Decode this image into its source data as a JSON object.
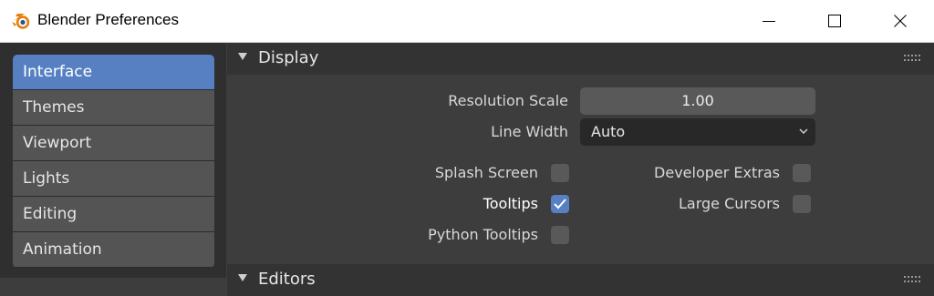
{
  "window": {
    "title": "Blender Preferences",
    "icons": {
      "app": "blender-logo-icon",
      "minimize": "minimize-icon",
      "maximize": "maximize-icon",
      "close": "close-icon"
    }
  },
  "sidebar": {
    "items": [
      {
        "label": "Interface",
        "active": true
      },
      {
        "label": "Themes",
        "active": false
      },
      {
        "label": "Viewport",
        "active": false
      },
      {
        "label": "Lights",
        "active": false
      },
      {
        "label": "Editing",
        "active": false
      },
      {
        "label": "Animation",
        "active": false
      }
    ]
  },
  "display": {
    "header": "Display",
    "resolution_scale": {
      "label": "Resolution Scale",
      "value": "1.00"
    },
    "line_width": {
      "label": "Line Width",
      "value": "Auto"
    },
    "checkboxes": {
      "splash_screen": {
        "label": "Splash Screen",
        "checked": false
      },
      "tooltips": {
        "label": "Tooltips",
        "checked": true
      },
      "python_tooltips": {
        "label": "Python Tooltips",
        "checked": false
      },
      "developer_extras": {
        "label": "Developer Extras",
        "checked": false
      },
      "large_cursors": {
        "label": "Large Cursors",
        "checked": false
      }
    }
  },
  "editors": {
    "header": "Editors"
  },
  "colors": {
    "accent": "#5680c2",
    "window_bg": "#3d3d3d",
    "sidebar_bg": "#2f2f2f",
    "header_bg": "#333333",
    "widget_bg": "#595959",
    "dropdown_bg": "#282828",
    "blender_orange": "#e87d0d"
  }
}
